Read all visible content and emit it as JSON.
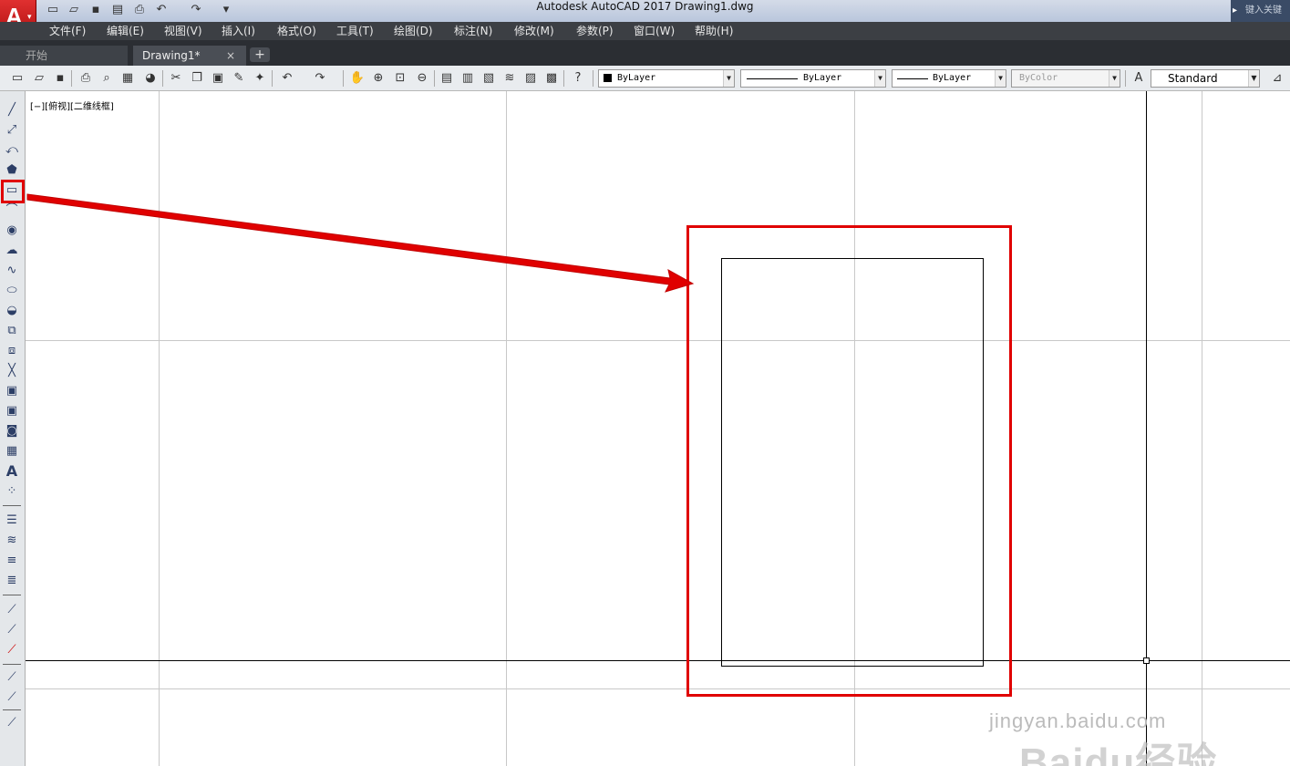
{
  "window": {
    "title": "Autodesk AutoCAD 2017    Drawing1.dwg",
    "search_placeholder": "键入关键"
  },
  "menu": [
    "文件(F)",
    "编辑(E)",
    "视图(V)",
    "插入(I)",
    "格式(O)",
    "工具(T)",
    "绘图(D)",
    "标注(N)",
    "修改(M)",
    "参数(P)",
    "窗口(W)",
    "帮助(H)"
  ],
  "tabs": {
    "start": "开始",
    "drawing": "Drawing1*",
    "close": "×",
    "add": "+"
  },
  "properties": {
    "color": "ByLayer",
    "linetype": "ByLayer",
    "lineweight": "ByLayer",
    "plotstyle": "ByColor",
    "textstyle": "Standard"
  },
  "viewport": {
    "label": "[−][俯视][二维线框]"
  },
  "watermark": {
    "brand": "Baidu经验",
    "url": "jingyan.baidu.com"
  },
  "colors": {
    "annotation_red": "#e00000",
    "menubar": "#3c3f44",
    "grid": "#c8c8c8"
  },
  "icons": {
    "left_tools": [
      "line-icon",
      "construction-line-icon",
      "polyline-icon",
      "polygon-icon",
      "rectangle-icon",
      "arc-icon",
      "circle-icon",
      "revision-cloud-icon",
      "spline-icon",
      "ellipse-icon",
      "ellipse-arc-icon",
      "insert-block-icon",
      "make-block-icon",
      "point-icon",
      "hatch-icon",
      "gradient-icon",
      "region-icon",
      "table-icon",
      "multiline-text-icon",
      "add-selected-icon"
    ]
  }
}
